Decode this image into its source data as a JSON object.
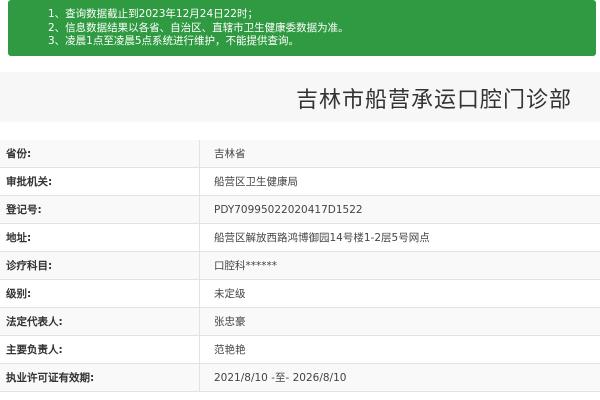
{
  "notice": {
    "lines": [
      "1、查询数据截止到2023年12月24日22时；",
      "2、信息数据结果以各省、自治区、直辖市卫生健康委数据为准。",
      "3、凌晨1点至凌晨5点系统进行维护，不能提供查询。"
    ]
  },
  "header": {
    "title": "吉林市船营承运口腔门诊部"
  },
  "details": {
    "rows": [
      {
        "label": "省份:",
        "value": "吉林省"
      },
      {
        "label": "审批机关:",
        "value": "船营区卫生健康局"
      },
      {
        "label": "登记号:",
        "value": "PDY70995022020417D1522"
      },
      {
        "label": "地址:",
        "value": "船营区解放西路鸿博御园14号楼1-2层5号网点"
      },
      {
        "label": "诊疗科目:",
        "value": "口腔科******"
      },
      {
        "label": "级别:",
        "value": "未定级"
      },
      {
        "label": "法定代表人:",
        "value": "张忠豪"
      },
      {
        "label": "主要负责人:",
        "value": "范艳艳"
      },
      {
        "label": "执业许可证有效期:",
        "value": "2021/8/10 -至- 2026/8/10"
      }
    ]
  },
  "colors": {
    "notice_bg": "#2f9a41",
    "title_band_bg": "#f7f7f7",
    "row_border": "#e2e2e2"
  }
}
